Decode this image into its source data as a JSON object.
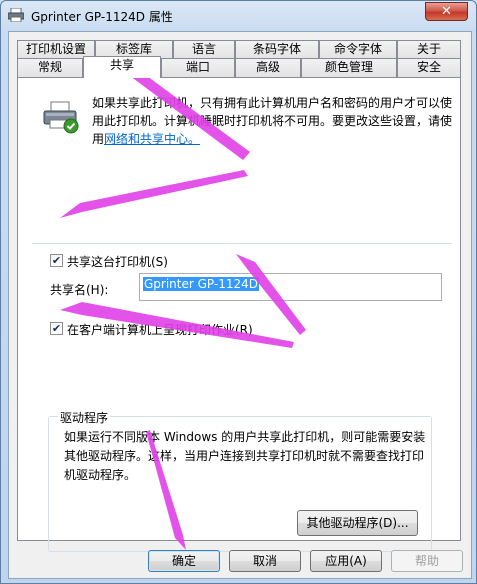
{
  "window": {
    "title": "Gprinter  GP-1124D 属性",
    "close_label": "✕"
  },
  "tabs_row1": [
    "打印机设置",
    "标签库",
    "语言",
    "条码字体",
    "命令字体",
    "关于"
  ],
  "tabs_row2": [
    "常规",
    "共享",
    "端口",
    "高级",
    "颜色管理",
    "安全"
  ],
  "selected_tab": "共享",
  "info": {
    "text": "如果共享此打印机，只有拥有此计算机用户名和密码的用户才可以使用此打印机。计算机睡眠时打印机将不可用。要更改这些设置，请使用",
    "link": "网络和共享中心。"
  },
  "share_checkbox": {
    "label": "共享这台打印机(S)",
    "checked": true
  },
  "share_name": {
    "label": "共享名(H):",
    "value": "Gprinter  GP-1124D"
  },
  "render_checkbox": {
    "label": "在客户端计算机上呈现打印作业(R)",
    "checked": true
  },
  "drivers": {
    "title": "驱动程序",
    "text": "如果运行不同版本 Windows 的用户共享此打印机，则可能需要安装其他驱动程序。这样，当用户连接到共享打印机时就不需要查找打印机驱动程序。",
    "button": "其他驱动程序(D)..."
  },
  "buttons": {
    "ok": "确定",
    "cancel": "取消",
    "apply": "应用(A)",
    "help": "帮助"
  },
  "colors": {
    "annotation_arrow": "#e040e8",
    "link": "#0066cc",
    "selection": "#3399ff"
  }
}
